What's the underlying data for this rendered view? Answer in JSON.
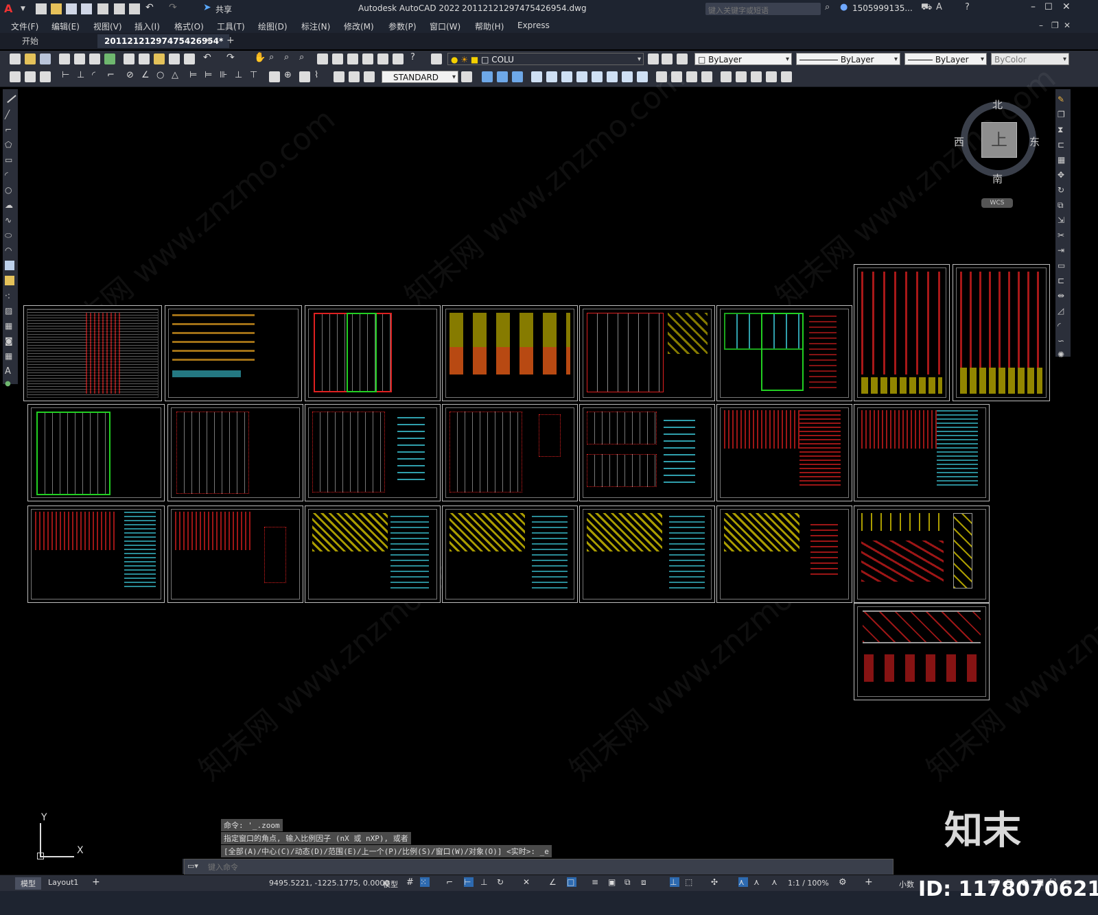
{
  "app_title": "Autodesk AutoCAD 2022",
  "file_title": "20112121297475426954.dwg",
  "share_label": "共享",
  "search": {
    "placeholder": "键入关键字或短语"
  },
  "user_name": "1505999135...",
  "menu": [
    "文件(F)",
    "编辑(E)",
    "视图(V)",
    "插入(I)",
    "格式(O)",
    "工具(T)",
    "绘图(D)",
    "标注(N)",
    "修改(M)",
    "参数(P)",
    "窗口(W)",
    "帮助(H)",
    "Express"
  ],
  "tabs": {
    "start": "开始",
    "active": "20112121297475426954*",
    "close": "✕",
    "add": "+"
  },
  "layer": {
    "name": "COLU"
  },
  "properties": {
    "color": "ByLayer",
    "linetype": "ByLayer",
    "lineweight": "ByLayer",
    "plotstyle": "ByColor"
  },
  "text_style": "STANDARD",
  "viewcube": {
    "north": "北",
    "south": "南",
    "east": "东",
    "west": "西",
    "top": "上",
    "wcs": "WCS"
  },
  "ucs": {
    "x": "X",
    "y": "Y"
  },
  "command_history": [
    "命令: '_.zoom",
    "指定窗口的角点, 输入比例因子 (nX 或 nXP), 或者",
    "[全部(A)/中心(C)/动态(D)/范围(E)/上一个(P)/比例(S)/窗口(W)/对象(O)] <实时>: _e"
  ],
  "command_input": {
    "placeholder": "键入命令"
  },
  "status": {
    "model_tab": "模型",
    "layout_tab": "Layout1",
    "coordinates": "9495.5221, -1225.1775, 0.0000",
    "model_label": "模型",
    "scale": "1:1 / 100%",
    "units": "小数"
  },
  "watermark_text": "知末网 www.znzmo.com",
  "brand": {
    "logo": "知末",
    "id": "ID: 1178070621"
  },
  "colors": {
    "red": "#e02020",
    "yellow": "#f4e000",
    "cyan": "#3cc8d8",
    "green": "#22d022",
    "white": "#ffffff"
  }
}
